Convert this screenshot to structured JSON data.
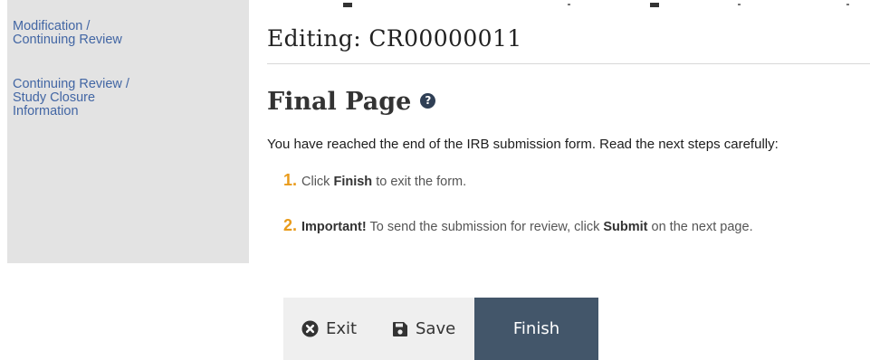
{
  "sidebar": {
    "items": [
      {
        "lines": [
          "Modification /",
          "Continuing Review"
        ]
      },
      {
        "lines": [
          "Continuing Review /",
          "Study Closure",
          "Information"
        ]
      }
    ]
  },
  "header": {
    "title": "Editing: CR00000011"
  },
  "main": {
    "heading": "Final Page",
    "help_icon": "question-circle-icon",
    "intro": "You have reached the end of the IRB submission form. Read the next steps carefully:",
    "steps": [
      {
        "number": "1.",
        "pre": "Click ",
        "bold": "Finish",
        "post": " to exit the form."
      },
      {
        "number": "2.",
        "bold_lead": "Important!",
        "pre": " To send the submission for review, click ",
        "bold": "Submit",
        "post": " on the next page."
      }
    ]
  },
  "buttons": {
    "exit_label": "Exit",
    "exit_icon": "times-circle-icon",
    "save_label": "Save",
    "save_icon": "floppy-disk-icon",
    "finish_label": "Finish"
  },
  "colors": {
    "link": "#4266a4",
    "step_number": "#e99b1a",
    "finish_bg": "#43566a",
    "sidebar_bg": "#e3e3e3"
  }
}
